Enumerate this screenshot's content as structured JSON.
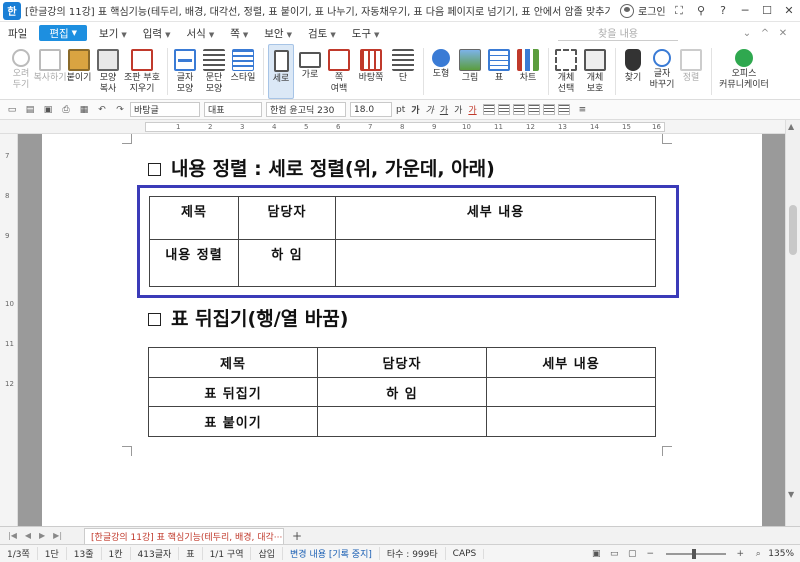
{
  "titlebar": {
    "app_icon": "한",
    "title": "[한글강의 11강] 표 핵심기능(테두리, 배경, 대각선, 정렬, 표 붙이기, 표 나누기, 자동채우기, 표 다음 페이지로 넘기기, 표 안에서 암졸 맞추기, 엑셀.hwp [C:\\Users\\user…",
    "login": "로그인"
  },
  "menu": {
    "items": [
      {
        "label": "파일"
      },
      {
        "label": "편집",
        "active": true
      },
      {
        "label": "보기"
      },
      {
        "label": "입력"
      },
      {
        "label": "서식"
      },
      {
        "label": "쪽"
      },
      {
        "label": "보안"
      },
      {
        "label": "검토"
      },
      {
        "label": "도구"
      }
    ],
    "search_placeholder": "찾을 내용"
  },
  "ribbon": {
    "groups": [
      [
        {
          "label": "오려\n두기",
          "icon": "scissors-icon",
          "dim": true
        },
        {
          "label": "복사하기",
          "icon": "copy-icon",
          "dim": true
        },
        {
          "label": "붙이기",
          "icon": "paste-icon"
        },
        {
          "label": "모양\n복사",
          "icon": "format-painter-icon"
        },
        {
          "label": "조판 부호\n지우기",
          "icon": "clear-format-icon"
        }
      ],
      [
        {
          "label": "글자\n모양",
          "icon": "char-shape-icon"
        },
        {
          "label": "문단\n모양",
          "icon": "paragraph-shape-icon"
        },
        {
          "label": "스타일",
          "icon": "style-icon"
        }
      ],
      [
        {
          "label": "세로",
          "icon": "portrait-icon",
          "selected": true
        },
        {
          "label": "가로",
          "icon": "landscape-icon"
        },
        {
          "label": "쪽\n여백",
          "icon": "margin-icon"
        },
        {
          "label": "바탕쪽",
          "icon": "master-page-icon"
        },
        {
          "label": "단",
          "icon": "columns-icon"
        }
      ],
      [
        {
          "label": "도형",
          "icon": "shape-icon"
        },
        {
          "label": "그림",
          "icon": "picture-icon"
        },
        {
          "label": "표",
          "icon": "table-icon"
        },
        {
          "label": "차트",
          "icon": "chart-icon"
        }
      ],
      [
        {
          "label": "개체\n선택",
          "icon": "object-select-icon"
        },
        {
          "label": "개체\n보호",
          "icon": "object-protect-icon"
        }
      ],
      [
        {
          "label": "찾기",
          "icon": "find-icon"
        },
        {
          "label": "글자\n바꾸기",
          "icon": "replace-icon"
        },
        {
          "label": "정렬",
          "icon": "sort-icon",
          "dim": true
        }
      ],
      [
        {
          "label": "오피스\n커뮤니케이터",
          "icon": "communicator-icon",
          "wide": true
        }
      ]
    ]
  },
  "toolbar2": {
    "style_name": "바탕글",
    "lang": "대표",
    "font_name": "한컴 윤고딕 230",
    "font_size": "18.0",
    "font_unit": "pt",
    "fmt_buttons": [
      "가",
      "가",
      "가",
      "가",
      "가"
    ]
  },
  "ruler": {
    "ticks": [
      "1",
      "2",
      "3",
      "4",
      "5",
      "6",
      "7",
      "8",
      "9",
      "10",
      "11",
      "12",
      "13",
      "14",
      "15",
      "16"
    ],
    "vticks": [
      "7",
      "8",
      "9",
      "10",
      "11",
      "12"
    ]
  },
  "document": {
    "heading1": "내용 정렬 : 세로 정렬(위, 가운데, 아래)",
    "table1": {
      "rows": [
        [
          "제목",
          "담당자",
          "세부 내용"
        ],
        [
          "내용 정렬",
          "하 임",
          ""
        ]
      ]
    },
    "heading2": "표 뒤집기(행/열 바꿈)",
    "table2": {
      "rows": [
        [
          "제목",
          "담당자",
          "세부 내용"
        ],
        [
          "표 뒤집기",
          "하 임",
          ""
        ],
        [
          "표 붙이기",
          "",
          ""
        ]
      ]
    }
  },
  "tabs": {
    "doc_tab": "[한글강의 11강] 표 핵심기능(테두리, 배경, 대각···"
  },
  "statusbar": {
    "items": [
      "1/3쪽",
      "1단",
      "13줄",
      "1칸",
      "413글자",
      "표",
      "1/1 구역",
      "삽입"
    ],
    "track": "변경 내용 [기록 중지]",
    "typing": "타수 : 999타",
    "caps": "CAPS",
    "zoom": "135%",
    "zoom_level": 135
  }
}
